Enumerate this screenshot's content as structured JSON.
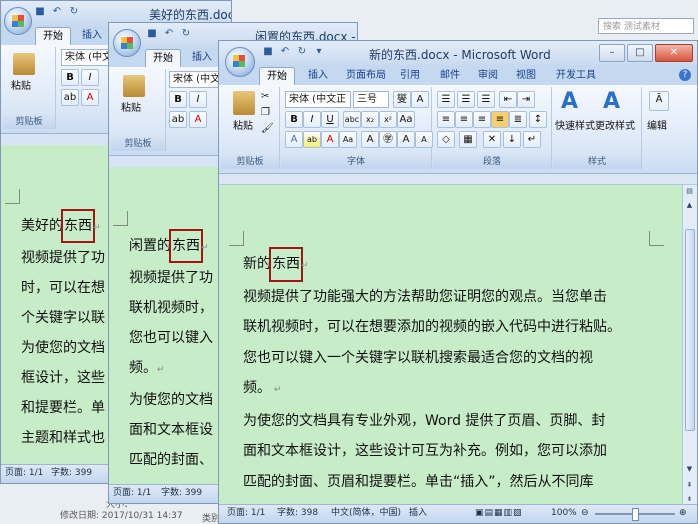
{
  "desktop": {
    "search_placeholder": "搜索 测试素材",
    "file_size_label": "大小：",
    "modified_date": "修改日期: 2017/10/31 14:37",
    "cut_label": "类别"
  },
  "windows": [
    {
      "id": "back",
      "title": "美好的东西.docx - Microsoft Word",
      "tabs": [
        "开始",
        "插入"
      ],
      "font_name": "宋体 (中文",
      "paragraph_title": "美好的",
      "highlight": "东西",
      "lines": [
        "视频提供了功",
        "时，可以在想",
        "个关键字以联",
        "为使您的文档",
        "框设计，这些",
        "和提要栏。单",
        "主题和样式也"
      ],
      "status_page": "页面: 1/1",
      "status_words": "字数: 399",
      "paste_label": "粘贴",
      "clipboard_label": "剪贴板"
    },
    {
      "id": "middle",
      "title": "闲置的东西.docx - Microsoft Word",
      "tabs": [
        "开始",
        "插入"
      ],
      "font_name": "宋体 (中文",
      "paragraph_title": "闲置的",
      "highlight": "东西",
      "lines": [
        "视频提供了功",
        "联机视频时，",
        "您也可以键入",
        "频。",
        "为使您的文档",
        "面和文本框设",
        "匹配的封面、"
      ],
      "status_page": "页面: 1/1",
      "status_words": "字数: 399",
      "paste_label": "粘贴",
      "clipboard_label": "剪贴板"
    },
    {
      "id": "front",
      "title": "新的东西.docx - Microsoft Word",
      "tabs": [
        "开始",
        "插入",
        "页面布局",
        "引用",
        "邮件",
        "审阅",
        "视图",
        "开发工具"
      ],
      "font_name": "宋体 (中文正",
      "font_size": "三号",
      "paste_label": "粘贴",
      "groups": {
        "clipboard": "剪贴板",
        "font": "字体",
        "paragraph": "段落",
        "styles": "样式",
        "edit": "编辑"
      },
      "quick_styles": "快速样式",
      "change_styles": "更改样式",
      "edit_btn": "编辑",
      "paragraph_title": "新的",
      "highlight": "东西",
      "lines": [
        "视频提供了功能强大的方法帮助您证明您的观点。当您单击",
        "联机视频时，可以在想要添加的视频的嵌入代码中进行粘贴。",
        "您也可以键入一个关键字以联机搜索最适合您的文档的视",
        "频。",
        "为使您的文档具有专业外观，Word 提供了页眉、页脚、封",
        "面和文本框设计，这些设计可互为补充。例如，您可以添加",
        "匹配的封面、页眉和提要栏。单击“插入”，然后从不同库"
      ],
      "status_page": "页面: 1/1",
      "status_words": "字数: 398",
      "status_lang": "中文(简体，中国)",
      "status_insert": "插入",
      "zoom": "100%"
    }
  ]
}
